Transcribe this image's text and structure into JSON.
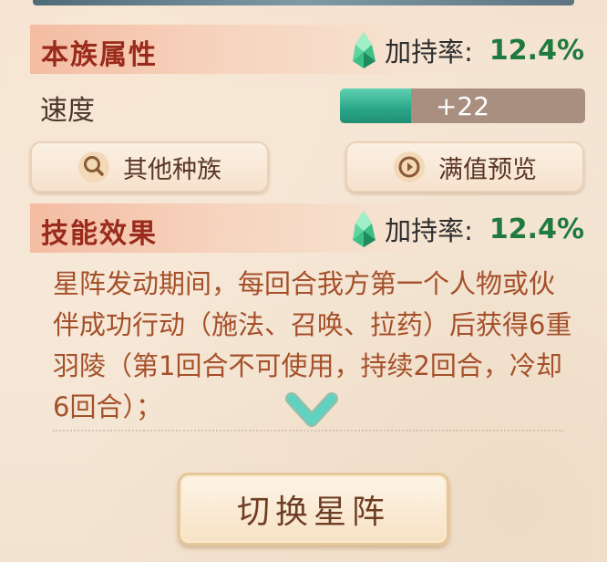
{
  "race_section": {
    "title": "本族属性",
    "bonus_label": "加持率:",
    "bonus_value": "12.4%",
    "gem_icon": "green-crystal-icon"
  },
  "stat": {
    "label": "速度",
    "value_text": "+22",
    "fill_fraction": 0.29,
    "fill_color": "#2da98b"
  },
  "buttons": {
    "other_races": {
      "label": "其他种族",
      "icon": "magnifier-icon"
    },
    "max_preview": {
      "label": "满值预览",
      "icon": "preview-eye-icon"
    }
  },
  "skill_section": {
    "title": "技能效果",
    "bonus_label": "加持率:",
    "bonus_value": "12.4%",
    "gem_icon": "green-crystal-icon",
    "description": "星阵发动期间，每回合我方第一个人物或伙伴成功行动（施法、召唤、拉药）后获得6重羽陵（第1回合不可使用，持续2回合，冷却6回合）；"
  },
  "switch_button": {
    "label": "切换星阵"
  },
  "colors": {
    "title_red": "#9a2a1c",
    "bonus_green": "#207a3e",
    "desc_text": "#a5502a",
    "chevron_teal": "#4ec3b0"
  }
}
